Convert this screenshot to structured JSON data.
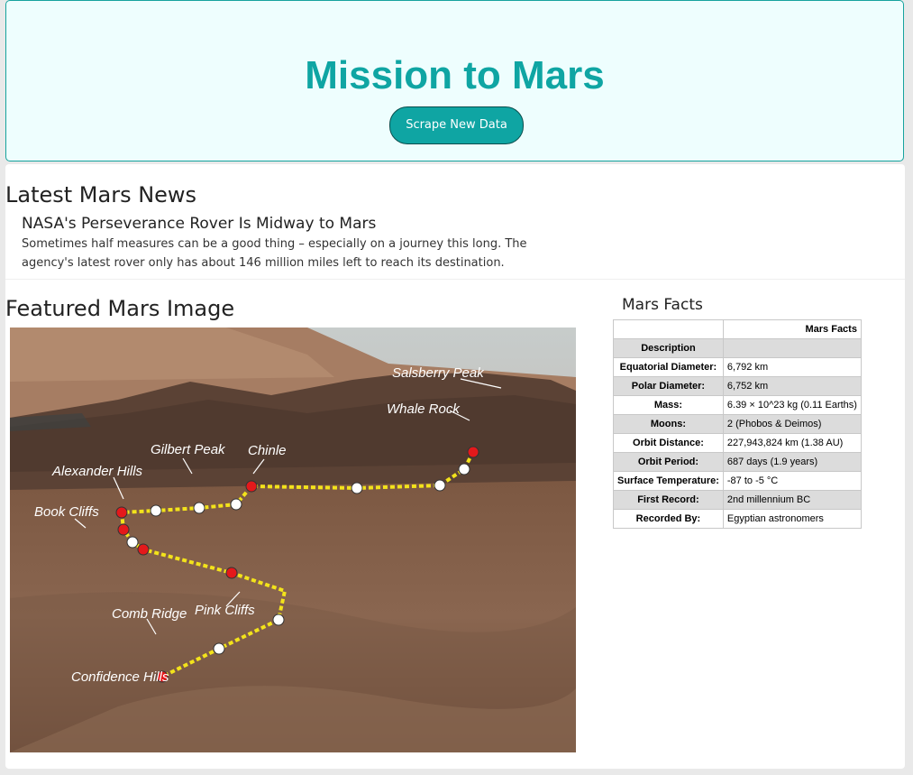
{
  "header": {
    "title": "Mission to Mars",
    "scrape_button": "Scrape New Data"
  },
  "news": {
    "heading": "Latest Mars News",
    "title": "NASA's Perseverance Rover Is Midway to Mars",
    "paragraph": "Sometimes half measures can be a good thing – especially on a journey this long. The agency's latest rover only has about 146 million miles left to reach its destination."
  },
  "featured_image": {
    "heading": "Featured Mars Image",
    "labels": [
      "Salsberry Peak",
      "Whale Rock",
      "Gilbert Peak",
      "Chinle",
      "Alexander Hills",
      "Book Cliffs",
      "Comb Ridge",
      "Pink Cliffs",
      "Confidence Hills"
    ]
  },
  "facts": {
    "heading": "Mars Facts",
    "table_header": "Mars Facts",
    "description_label": "Description",
    "rows": [
      {
        "label": "Equatorial Diameter:",
        "value": "6,792 km"
      },
      {
        "label": "Polar Diameter:",
        "value": "6,752 km"
      },
      {
        "label": "Mass:",
        "value": "6.39 × 10^23 kg (0.11 Earths)"
      },
      {
        "label": "Moons:",
        "value": "2 (Phobos & Deimos)"
      },
      {
        "label": "Orbit Distance:",
        "value": "227,943,824 km (1.38 AU)"
      },
      {
        "label": "Orbit Period:",
        "value": "687 days (1.9 years)"
      },
      {
        "label": "Surface Temperature:",
        "value": "-87 to -5 °C"
      },
      {
        "label": "First Record:",
        "value": "2nd millennium BC"
      },
      {
        "label": "Recorded By:",
        "value": "Egyptian astronomers"
      }
    ]
  },
  "colors": {
    "accent": "#0fa5a3",
    "header_bg": "#eefefe"
  }
}
